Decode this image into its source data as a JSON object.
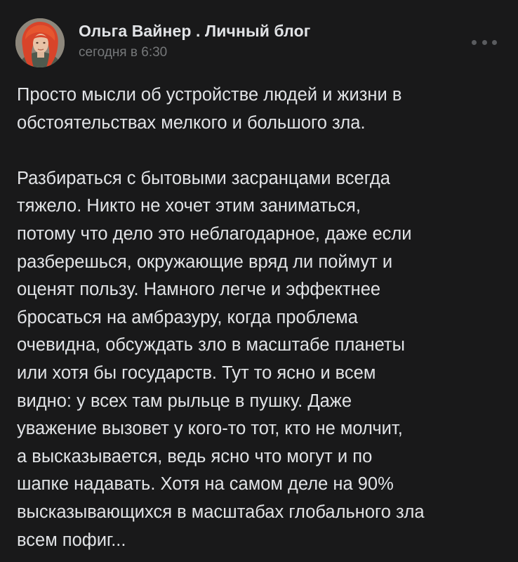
{
  "post": {
    "author": "Ольга Вайнер . Личный блог",
    "time": "сегодня в 6:30",
    "more_icon": "more-horizontal-icon",
    "paragraphs": [
      [
        "Просто мысли об устройстве людей и жизни в",
        "обстоятельствах мелкого и большого зла."
      ],
      [
        "Разбираться с бытовыми засранцами всегда",
        "тяжело. Никто не хочет этим заниматься,",
        "потому что дело это неблагодарное, даже если",
        "разберешься, окружающие вряд ли поймут и",
        "оценят пользу. Намного легче и эффектнее",
        "бросаться на амбразуру, когда проблема",
        "очевидна, обсуждать зло в масштабе планеты",
        "или хотя бы государств. Тут то ясно и всем",
        "видно: у всех там рыльце в пушку. Даже",
        "уважение вызовет у кого-то тот, кто не молчит,",
        "а высказывается, ведь ясно что могут и по",
        "шапке надавать. Хотя на самом деле на 90%",
        "высказывающихся в масштабах глобального зла",
        "всем пофиг..."
      ]
    ]
  },
  "colors": {
    "background": "#19191a",
    "text": "#e1e3e6",
    "secondary_text": "#76787a",
    "avatar_hair": "#d8442a"
  }
}
